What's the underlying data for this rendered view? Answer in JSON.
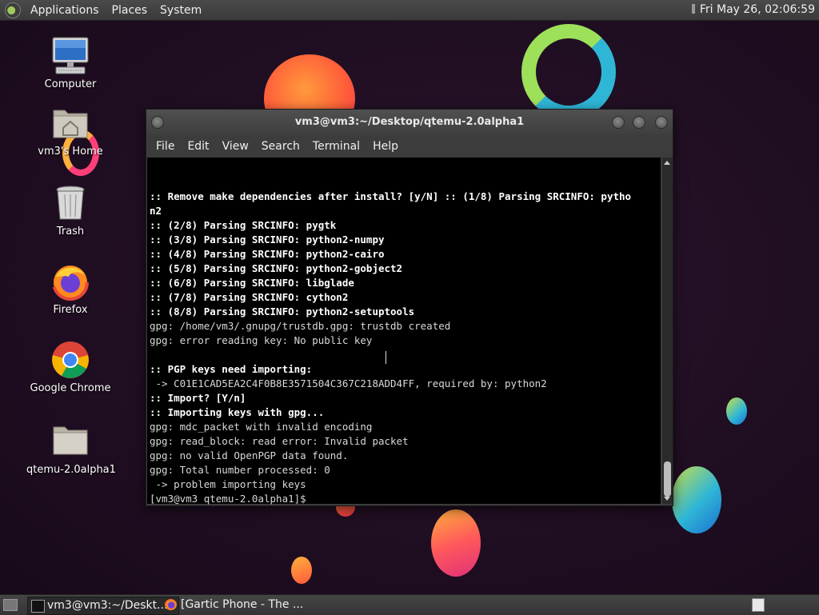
{
  "top_panel": {
    "menus": [
      "Applications",
      "Places",
      "System"
    ],
    "clock": "Fri May 26, 02:06:59"
  },
  "desktop_icons": [
    {
      "label": "Computer",
      "icon": "computer-icon"
    },
    {
      "label": "vm3's Home",
      "icon": "home-folder-icon"
    },
    {
      "label": "Trash",
      "icon": "trash-icon"
    },
    {
      "label": "Firefox",
      "icon": "firefox-icon"
    },
    {
      "label": "Google Chrome",
      "icon": "chrome-icon"
    },
    {
      "label": "qtemu-2.0alpha1",
      "icon": "folder-icon"
    }
  ],
  "terminal": {
    "title": "vm3@vm3:~/Desktop/qtemu-2.0alpha1",
    "menu": [
      "File",
      "Edit",
      "View",
      "Search",
      "Terminal",
      "Help"
    ],
    "lines": [
      ":: Remove make dependencies after install? [y/N] :: (1/8) Parsing SRCINFO: pytho",
      "n2",
      ":: (2/8) Parsing SRCINFO: pygtk",
      ":: (3/8) Parsing SRCINFO: python2-numpy",
      ":: (4/8) Parsing SRCINFO: python2-cairo",
      ":: (5/8) Parsing SRCINFO: python2-gobject2",
      ":: (6/8) Parsing SRCINFO: libglade",
      ":: (7/8) Parsing SRCINFO: cython2",
      ":: (8/8) Parsing SRCINFO: python2-setuptools",
      "gpg: /home/vm3/.gnupg/trustdb.gpg: trustdb created",
      "gpg: error reading key: No public key",
      "",
      ":: PGP keys need importing:",
      " -> C01E1CAD5EA2C4F0B8E3571504C367C218ADD4FF, required by: python2",
      ":: Import? [Y/n]",
      ":: Importing keys with gpg...",
      "gpg: mdc_packet with invalid encoding",
      "gpg: read_block: read error: Invalid packet",
      "gpg: no valid OpenPGP data found.",
      "gpg: Total number processed: 0",
      " -> problem importing keys",
      "[vm3@vm3 qtemu-2.0alpha1]$"
    ],
    "bold_lines": [
      0,
      1,
      2,
      3,
      4,
      5,
      6,
      7,
      8,
      12,
      14,
      15
    ]
  },
  "taskbar": {
    "tasks": [
      {
        "label": "vm3@vm3:~/Deskt...",
        "icon": "terminal-icon",
        "active": true
      },
      {
        "label": "[Gartic Phone - The ...",
        "icon": "firefox-icon",
        "active": false
      }
    ]
  },
  "colors": {
    "accent_orange": "#f26a3a",
    "accent_cyan": "#2fb6d6",
    "terminal_bg": "#000000"
  }
}
